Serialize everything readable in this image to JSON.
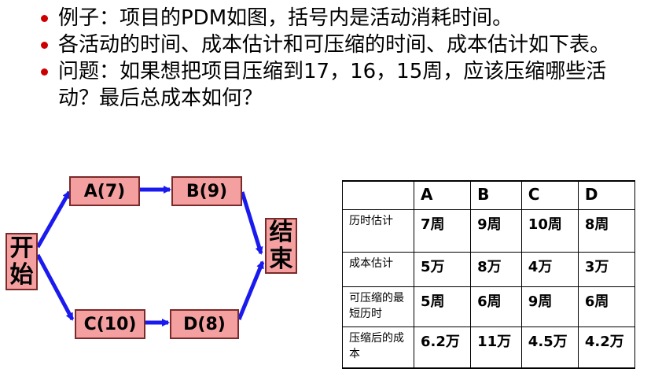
{
  "bullets": [
    "例子：项目的PDM如图，括号内是活动消耗时间。",
    "各活动的时间、成本估计和可压缩的时间、成本估计如下表。",
    "问题：如果想把项目压缩到17，16，15周，应该压缩哪些活动？最后总成本如何？"
  ],
  "diagram": {
    "start": [
      "开",
      "始"
    ],
    "end": [
      "结",
      "束"
    ],
    "nodes": {
      "a": "A(7)",
      "b": "B(9)",
      "c": "C(10)",
      "d": "D(8)"
    }
  },
  "colors": {
    "node_fill": "#f4a0a0",
    "node_border": "#7a2a2a",
    "arrow": "#1a1aee",
    "bullet": "#cc0000"
  },
  "table": {
    "headers": [
      "",
      "A",
      "B",
      "C",
      "D"
    ],
    "rows": [
      {
        "label": "历时估计",
        "values": [
          "7周",
          "9周",
          "10周",
          "8周"
        ]
      },
      {
        "label": "成本估计",
        "values": [
          "5万",
          "8万",
          "4万",
          "3万"
        ]
      },
      {
        "label": "可压缩的最短历时",
        "values": [
          "5周",
          "6周",
          "9周",
          "6周"
        ]
      },
      {
        "label": "压缩后的成本",
        "values": [
          "6.2万",
          "11万",
          "4.5万",
          "4.2万"
        ]
      }
    ]
  }
}
